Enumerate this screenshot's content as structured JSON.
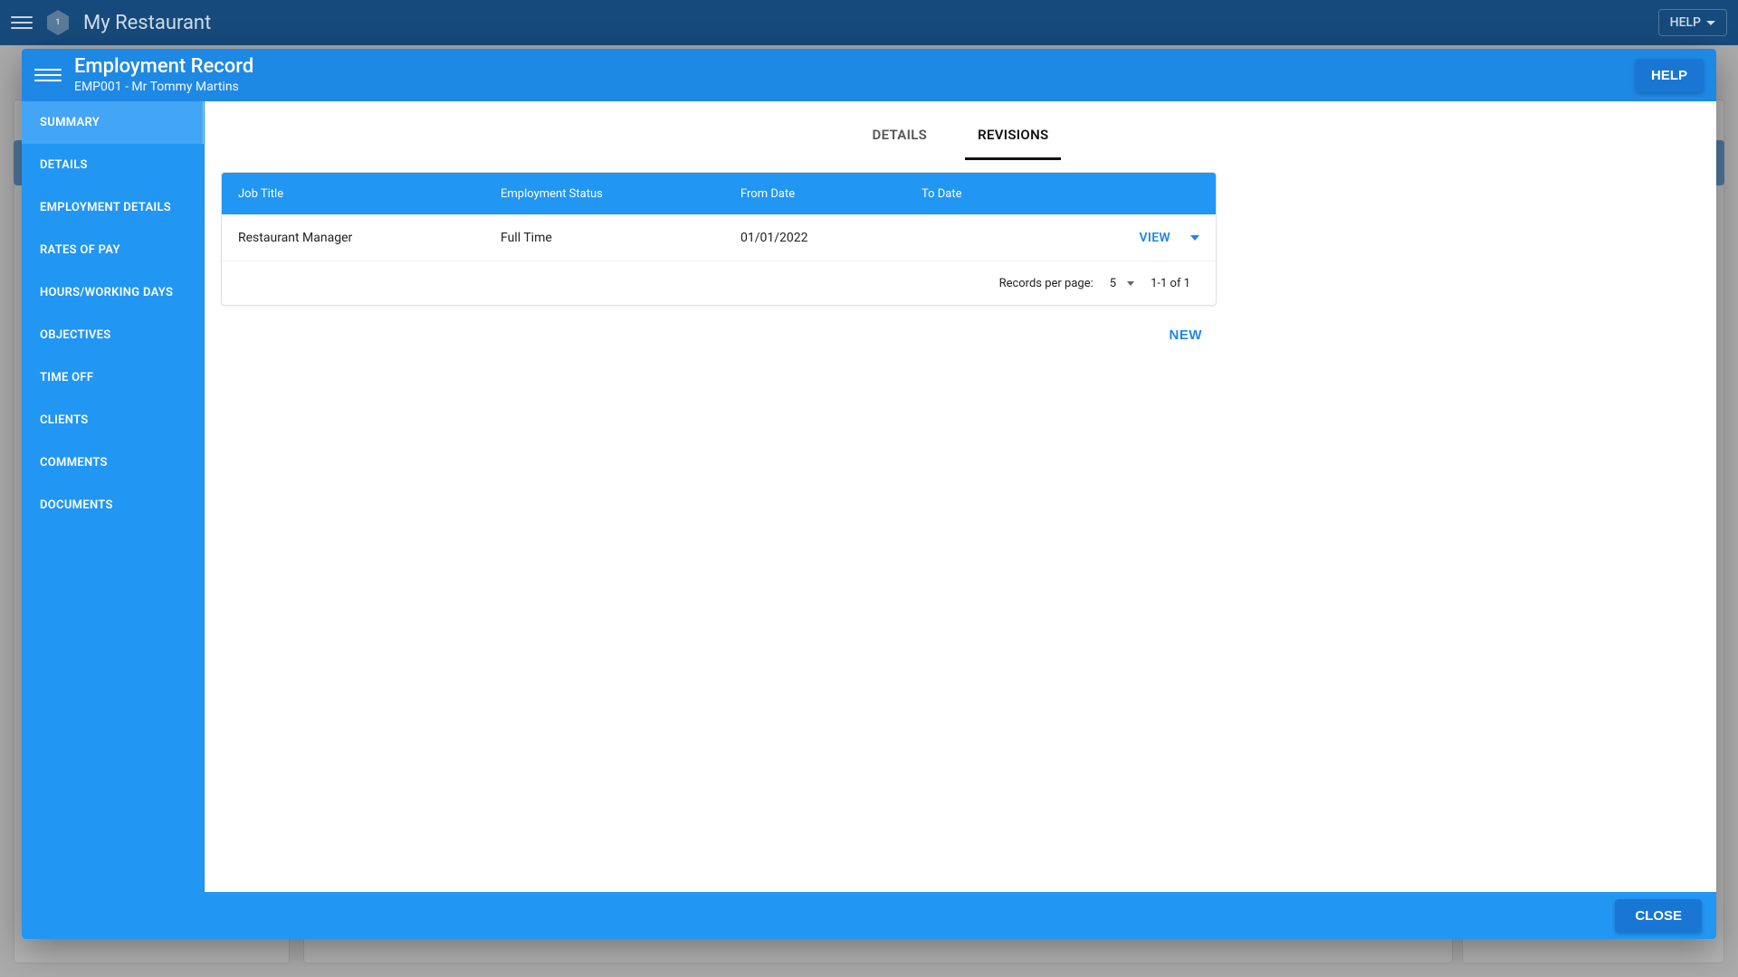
{
  "app": {
    "title": "My Restaurant",
    "help_label": "HELP",
    "logo_text": "1"
  },
  "modal": {
    "title": "Employment Record",
    "subtitle": "EMP001 - Mr Tommy Martins",
    "help_label": "HELP",
    "close_label": "CLOSE"
  },
  "sidebar": {
    "items": [
      {
        "label": "SUMMARY",
        "active": true
      },
      {
        "label": "DETAILS",
        "active": false
      },
      {
        "label": "EMPLOYMENT DETAILS",
        "active": false
      },
      {
        "label": "RATES OF PAY",
        "active": false
      },
      {
        "label": "HOURS/WORKING DAYS",
        "active": false
      },
      {
        "label": "OBJECTIVES",
        "active": false
      },
      {
        "label": "TIME OFF",
        "active": false
      },
      {
        "label": "CLIENTS",
        "active": false
      },
      {
        "label": "COMMENTS",
        "active": false
      },
      {
        "label": "DOCUMENTS",
        "active": false
      }
    ]
  },
  "tabs": {
    "details": "DETAILS",
    "revisions": "REVISIONS",
    "active": "revisions"
  },
  "table": {
    "headers": {
      "job_title": "Job Title",
      "employment_status": "Employment Status",
      "from_date": "From Date",
      "to_date": "To Date"
    },
    "rows": [
      {
        "job_title": "Restaurant Manager",
        "employment_status": "Full Time",
        "from_date": "01/01/2022",
        "to_date": "",
        "view_label": "VIEW"
      }
    ],
    "footer": {
      "records_per_page_label": "Records per page:",
      "records_per_page_value": "5",
      "range_label": "1-1 of 1"
    }
  },
  "actions": {
    "new_label": "NEW"
  }
}
